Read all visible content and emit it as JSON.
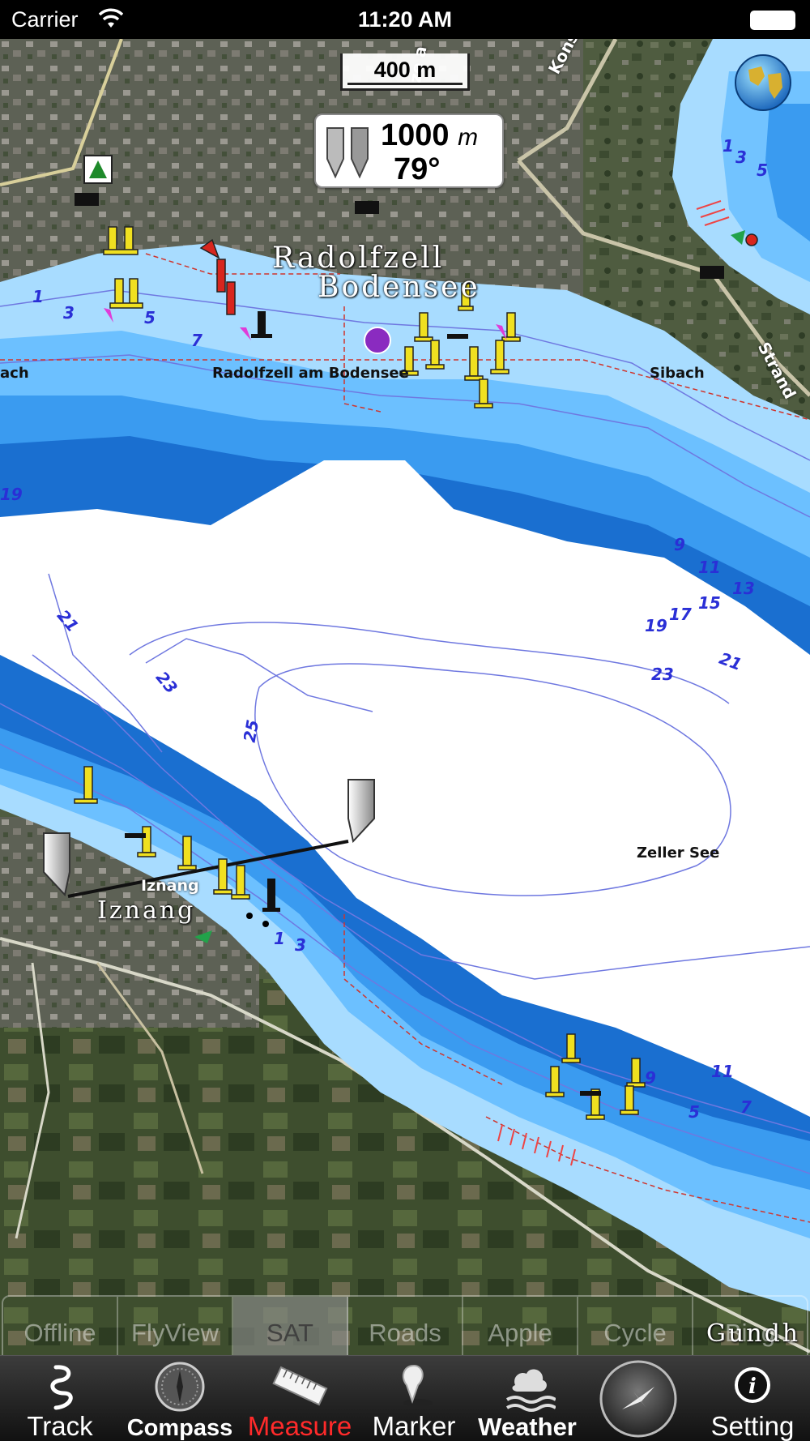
{
  "status_bar": {
    "carrier": "Carrier",
    "time": "11:20 AM"
  },
  "map": {
    "scale_label": "400 m",
    "measure": {
      "distance_value": "1000",
      "distance_unit": "m",
      "bearing": "79°"
    },
    "place_labels": {
      "radolfzell_line1": "Radolfzell",
      "radolfzell_line2": "Bodensee",
      "radolfzell_small": "Radolfzell am Bodensee",
      "sibach": "Sibach",
      "ach_partial": "ach",
      "zeller_see": "Zeller See",
      "iznang_small": "Iznang",
      "iznang_large": "Iznang",
      "gundh_partial": "Gundh",
      "konstanzer_street": "Konstanze",
      "strand_street": "Strand",
      "ze_street": "ze a"
    },
    "depths": [
      "1",
      "3",
      "5",
      "7",
      "19",
      "21",
      "23",
      "25",
      "9",
      "11",
      "13",
      "15",
      "17",
      "19",
      "21",
      "23",
      "1",
      "3",
      "5",
      "9",
      "11",
      "7",
      "1",
      "3",
      "5"
    ],
    "globe_icon": "globe-icon"
  },
  "map_types": {
    "items": [
      "Offline",
      "FlyView",
      "SAT",
      "Roads",
      "Apple",
      "Cycle",
      "Bing"
    ],
    "selected": "SAT"
  },
  "toolbar": {
    "track": "Track",
    "compass": "Compass",
    "measure": "Measure",
    "marker": "Marker",
    "weather": "Weather",
    "setting": "Setting",
    "active": "Measure"
  },
  "colors": {
    "deep_water": "#ffffff",
    "water_dark": "#1a6fd0",
    "water_mid": "#3a9bf0",
    "water_light": "#a8dcff",
    "land": "#4a5a3a",
    "active_tab": "#ff2a2a"
  }
}
